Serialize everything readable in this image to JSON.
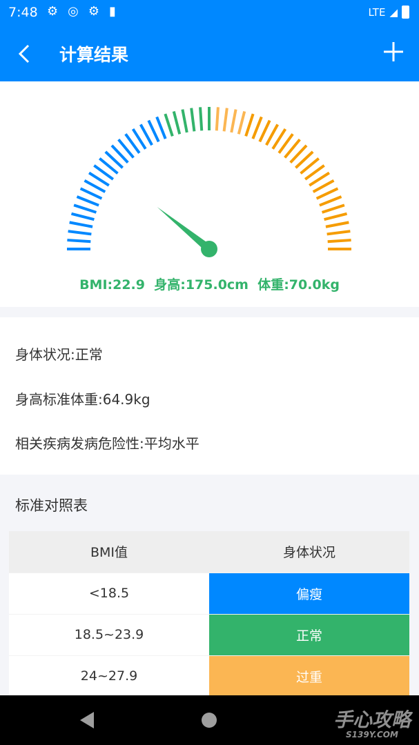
{
  "status_bar": {
    "time": "7:48",
    "network": "LTE",
    "icons": [
      "gear-icon",
      "vpn-icon",
      "data-saver-icon",
      "sd-card-icon",
      "signal-icon",
      "battery-icon"
    ]
  },
  "app_bar": {
    "title": "计算结果",
    "back_icon": "chevron-left-icon",
    "add_icon": "plus-icon"
  },
  "gauge": {
    "bmi": 22.9,
    "scale_colors": {
      "underweight": "#0088ff",
      "normal": "#33b36b",
      "overweight": "#fbb653",
      "obese": "#f59c00"
    },
    "summary": "BMI:22.9  身高:175.0cm  体重:70.0kg"
  },
  "info": {
    "status": "身体状况:正常",
    "standard_weight": "身高标准体重:64.9kg",
    "risk": "相关疾病发病危险性:平均水平"
  },
  "reference": {
    "title": "标准对照表",
    "headers": [
      "BMI值",
      "身体状况"
    ],
    "rows": [
      {
        "range": "<18.5",
        "status": "偏瘦",
        "color": "#0088ff"
      },
      {
        "range": "18.5~23.9",
        "status": "正常",
        "color": "#33b36b"
      },
      {
        "range": "24~27.9",
        "status": "过重",
        "color": "#fbb653"
      }
    ]
  },
  "watermark": {
    "text": "手心攻略",
    "sub": "S139Y.COM"
  }
}
